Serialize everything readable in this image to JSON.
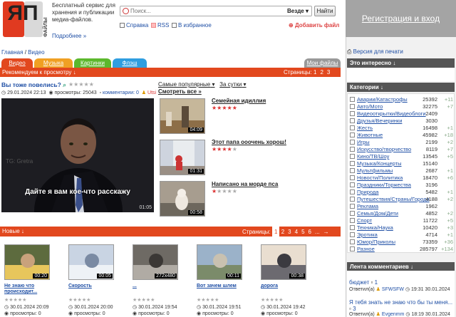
{
  "header": {
    "logo_text": "ЯП",
    "logo_vertical": "ФАЙЛЫ",
    "tagline": "Бесплатный сервис для хранения и публикации медиа-файлов.",
    "more_link": "Подробнее »",
    "search_placeholder": "Поиск...",
    "search_scope": "Везде",
    "search_button": "Найти",
    "links": {
      "help": "Справка",
      "rss": "RSS",
      "favorites": "В избранное",
      "add_file": "Добавить файл"
    }
  },
  "right": {
    "register": "Регистрация и вход",
    "print_version": "Версия для печати",
    "interesting_title": "Это интересно ↓",
    "categories_title": "Категории ↓",
    "categories": [
      {
        "name": "Аварии/Катастрофы",
        "count": "25392",
        "delta": "+11"
      },
      {
        "name": "Авто/Мото",
        "count": "32275",
        "delta": "+7"
      },
      {
        "name": "Видеооткрытки/Видеоблоги",
        "count": "2409",
        "delta": ""
      },
      {
        "name": "Друзья/Вечеринки",
        "count": "3030",
        "delta": ""
      },
      {
        "name": "Жесть",
        "count": "16498",
        "delta": "+1"
      },
      {
        "name": "Животные",
        "count": "45982",
        "delta": "+18"
      },
      {
        "name": "Игры",
        "count": "2199",
        "delta": "+2"
      },
      {
        "name": "Искусство/творчество",
        "count": "8119",
        "delta": "+7"
      },
      {
        "name": "Кино/ТВ/Шоу",
        "count": "13545",
        "delta": "+5"
      },
      {
        "name": "Музыка/Концерты",
        "count": "15140",
        "delta": ""
      },
      {
        "name": "Мультфильмы",
        "count": "2687",
        "delta": "+1"
      },
      {
        "name": "Новости/Политика",
        "count": "18470",
        "delta": "+6"
      },
      {
        "name": "Праздники/Торжества",
        "count": "3196",
        "delta": ""
      },
      {
        "name": "Природа",
        "count": "5482",
        "delta": "+1"
      },
      {
        "name": "Путешествия/Страны/Города",
        "count": "4188",
        "delta": "+2"
      },
      {
        "name": "Реклама",
        "count": "1962",
        "delta": ""
      },
      {
        "name": "Семья/Дом/Дети",
        "count": "4852",
        "delta": "+2"
      },
      {
        "name": "Спорт",
        "count": "11722",
        "delta": "+5"
      },
      {
        "name": "Техника/Наука",
        "count": "10420",
        "delta": "+3"
      },
      {
        "name": "Эротика",
        "count": "4714",
        "delta": "+1"
      },
      {
        "name": "Юмор/Приколы",
        "count": "73359",
        "delta": "+36"
      },
      {
        "name": "Разное",
        "count": "285797",
        "delta": "+134"
      }
    ],
    "comments_title": "Лента комментариев ↓",
    "comments": [
      {
        "title": "бюджет",
        "count": "1",
        "by": "Ответил(а)",
        "user": "SFWSFW",
        "time": "19:31 30.01.2024"
      },
      {
        "title": "Я тебя знать не знаю что бы ты меня...",
        "count": "3",
        "by": "Ответил(а)",
        "user": "Evgenmm",
        "time": "18:19 30.01.2024"
      }
    ]
  },
  "nav": {
    "crumb_home": "Главная",
    "crumb_sep": "/",
    "crumb_current": "Видео",
    "tabs": [
      "Видео",
      "Музыка",
      "Картинки",
      "Флэш"
    ],
    "my_files": "Мои файлы"
  },
  "recommend": {
    "bar_label": "Рекомендуем к просмотру ↓",
    "pages_label": "Страницы:",
    "pages": [
      "1",
      "2",
      "3"
    ],
    "title": "Вы тоже повелись?",
    "date": "29.01.2024 22:13",
    "views": "просмотры: 25043",
    "comments": "комментарии: 0",
    "user": "Utsi",
    "subtitle": "Дайте я вам кое-что расскажу",
    "player_time": "01:05",
    "watermark": "TG: Gretra",
    "sort": "Самые популярные",
    "period": "За сутки",
    "watch_all": "Смотреть все »"
  },
  "side_videos": [
    {
      "title": "Семейная идиллия",
      "duration": "04:09",
      "rating": 5
    },
    {
      "title": "Этот папа ооочень хорош!",
      "duration": "01:31",
      "rating": 4
    },
    {
      "title": "Написано на морде пса",
      "duration": "00:58",
      "rating": 1
    }
  ],
  "new_videos": {
    "bar_label": "Новые ↓",
    "pages_label": "Страницы:",
    "pages": [
      "1",
      "2",
      "3",
      "4",
      "5",
      "6",
      "..."
    ],
    "next": "→",
    "items": [
      {
        "title": "Не знаю что происходит...",
        "duration": "00:20",
        "date": "30.01.2024 20:09",
        "views": "просмотры: 0"
      },
      {
        "title": "Скорость",
        "duration": "00:05",
        "date": "30.01.2024 20:00",
        "views": "просмотры: 0"
      },
      {
        "title": "...",
        "duration": "272x480",
        "date": "30.01.2024 19:54",
        "views": "просмотры: 0"
      },
      {
        "title": "Вот зачем шлем",
        "duration": "00:11",
        "date": "30.01.2024 19:51",
        "views": "просмотры: 0"
      },
      {
        "title": "дорога",
        "duration": "00:38",
        "date": "30.01.2024 19:42",
        "views": "просмотры: 0"
      }
    ]
  },
  "colors": {
    "red": "#e2481e",
    "tab_video": "#e2481e",
    "tab_music": "#f0a023",
    "tab_pics": "#5cb82c",
    "tab_flash": "#2f9ee0"
  }
}
